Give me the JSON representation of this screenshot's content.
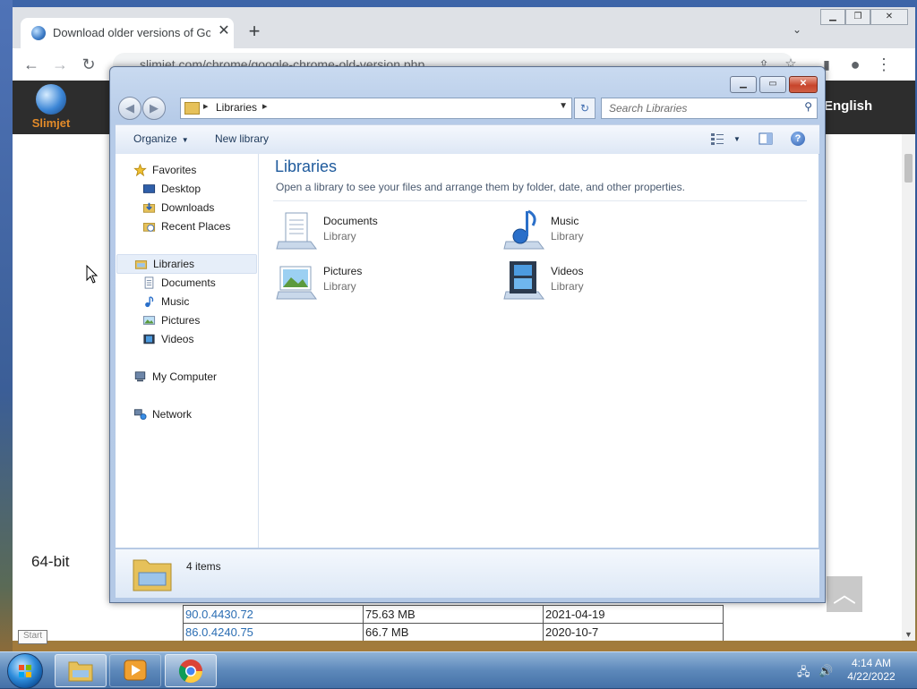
{
  "browser": {
    "tab_title": "Download older versions of Goo",
    "url": "slimjet.com/chrome/google-chrome-old-version.php",
    "site_logo_text": "Slimjet",
    "language": "English",
    "page_64bit_label": "64-bit",
    "versions": [
      {
        "version": "90.0.4430.72",
        "size": "75.63 MB",
        "date": "2021-04-19"
      },
      {
        "version": "86.0.4240.75",
        "size": "66.7 MB",
        "date": "2020-10-7"
      }
    ]
  },
  "explorer": {
    "breadcrumb": "Libraries",
    "search_placeholder": "Search Libraries",
    "commands": {
      "organize": "Organize",
      "new_library": "New library"
    },
    "nav": {
      "favorites": {
        "label": "Favorites",
        "items": [
          "Desktop",
          "Downloads",
          "Recent Places"
        ]
      },
      "libraries": {
        "label": "Libraries",
        "items": [
          "Documents",
          "Music",
          "Pictures",
          "Videos"
        ]
      },
      "computer": "My Computer",
      "network": "Network"
    },
    "heading": "Libraries",
    "subheading": "Open a library to see your files and arrange them by folder, date, and other properties.",
    "libraries": [
      {
        "name": "Documents",
        "kind": "Library",
        "icon": "documents-library-icon"
      },
      {
        "name": "Music",
        "kind": "Library",
        "icon": "music-library-icon"
      },
      {
        "name": "Pictures",
        "kind": "Library",
        "icon": "pictures-library-icon"
      },
      {
        "name": "Videos",
        "kind": "Library",
        "icon": "videos-library-icon"
      }
    ],
    "status_count": "4 items"
  },
  "taskbar": {
    "start_tooltip": "Start",
    "time": "4:14 AM",
    "date": "4/22/2022"
  },
  "colors": {
    "heading_blue": "#1e5a9c",
    "link_blue": "#2a6db3",
    "slimjet_orange": "#e38b29"
  }
}
